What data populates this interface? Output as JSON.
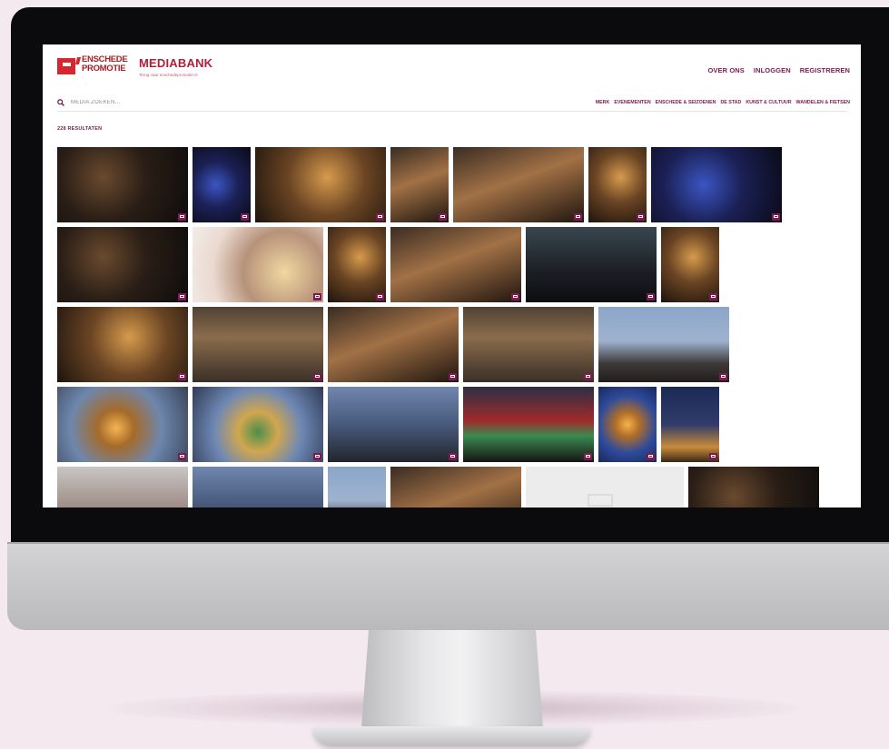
{
  "logo": {
    "line1": "ENSCHEDE",
    "line2": "PROMOTIE"
  },
  "brand": {
    "title": "MEDIABANK",
    "subtitle": "Terug naar enschedepromotie.nl"
  },
  "top_nav": [
    "OVER ONS",
    "INLOGGEN",
    "REGISTREREN"
  ],
  "search": {
    "placeholder": "MEDIA ZOEKEN..."
  },
  "categories": [
    "MERK",
    "EVENEMENTEN",
    "ENSCHEDE & SEIZOENEN",
    "DE STAD",
    "KUNST & CULTUUR",
    "WANDELEN & FIETSEN"
  ],
  "results_label": "228 RESULTATEN",
  "colors": {
    "brand_red": "#d7262f",
    "accent_purple": "#7b1b52",
    "page_background": "#f4e9ef"
  },
  "media_type_icon": "image-icon"
}
